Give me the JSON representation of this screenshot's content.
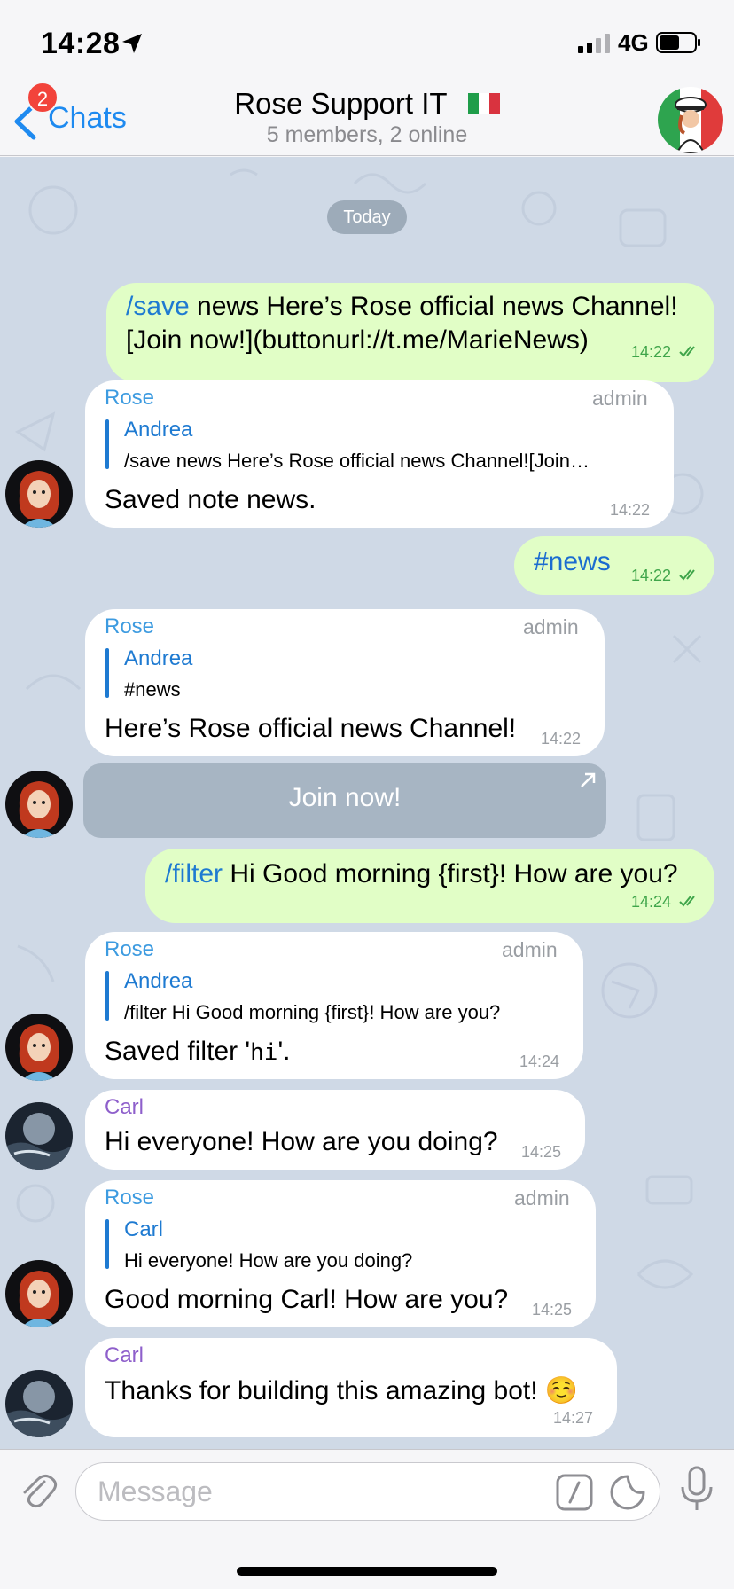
{
  "status_bar": {
    "time": "14:28",
    "network": "4G"
  },
  "header": {
    "back_label": "Chats",
    "unread_count": "2",
    "title": "Rose Support IT",
    "subtitle": "5 members, 2 online"
  },
  "date_divider": "Today",
  "messages": [
    {
      "dir": "out",
      "cmd": "/save",
      "line1": " news Here’s Rose official news Channel!",
      "line2": "[Join now!](buttonurl://t.me/MarieNews)",
      "time": "14:22"
    },
    {
      "dir": "in",
      "sender": "Rose",
      "role": "admin",
      "reply_name": "Andrea",
      "reply_text": "/save news Here’s Rose official news Channel![Join…",
      "text": "Saved note news.",
      "time": "14:22"
    },
    {
      "dir": "out",
      "text": "#news",
      "time": "14:22"
    },
    {
      "dir": "in",
      "sender": "Rose",
      "role": "admin",
      "reply_name": "Andrea",
      "reply_text": "#news",
      "text": "Here’s Rose official news Channel!",
      "time": "14:22",
      "button": "Join now!"
    },
    {
      "dir": "out",
      "cmd": "/filter",
      "text": " Hi Good morning {first}! How are you?",
      "time": "14:24"
    },
    {
      "dir": "in",
      "sender": "Rose",
      "role": "admin",
      "reply_name": "Andrea",
      "reply_text": "/filter Hi Good morning {first}! How are you?",
      "text_pre": "Saved filter '",
      "text_code": "hi",
      "text_post": "'.",
      "time": "14:24"
    },
    {
      "dir": "in",
      "sender": "Carl",
      "text": "Hi everyone! How are you doing?",
      "time": "14:25"
    },
    {
      "dir": "in",
      "sender": "Rose",
      "role": "admin",
      "reply_name": "Carl",
      "reply_text": "Hi everyone! How are you doing?",
      "text": "Good morning Carl! How are you?",
      "time": "14:25"
    },
    {
      "dir": "in",
      "sender": "Carl",
      "text": "Thanks for building this amazing bot! ☺️",
      "time": "14:27"
    }
  ],
  "input": {
    "placeholder": "Message"
  },
  "colors": {
    "accent": "#1e8af0",
    "outgoing_bubble": "#e1fec6",
    "incoming_bubble": "#ffffff",
    "chat_background": "#cfd9e6",
    "badge": "#f2433b"
  },
  "icons": [
    "location-arrow-icon",
    "signal-icon",
    "battery-icon",
    "back-chevron-icon",
    "italy-flag-icon",
    "double-check-icon",
    "external-link-icon",
    "attach-icon",
    "command-icon",
    "sticker-icon",
    "microphone-icon"
  ]
}
